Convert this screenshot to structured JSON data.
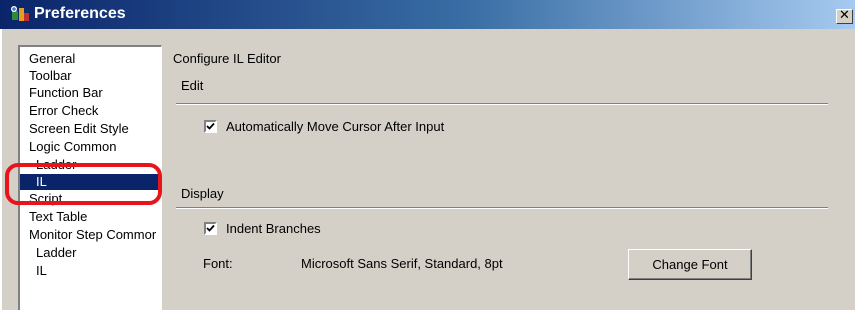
{
  "window": {
    "title": "Preferences",
    "close_glyph": "✕"
  },
  "tree": {
    "items": [
      {
        "label": "General"
      },
      {
        "label": "Toolbar"
      },
      {
        "label": "Function Bar"
      },
      {
        "label": "Error Check"
      },
      {
        "label": "Screen Edit Style"
      },
      {
        "label": "Logic Common"
      },
      {
        "label": "Ladder"
      },
      {
        "label": "IL"
      },
      {
        "label": "Script"
      },
      {
        "label": "Text Table"
      },
      {
        "label": "Monitor Step Commor"
      },
      {
        "label": "Ladder"
      },
      {
        "label": "IL"
      }
    ],
    "selected": "IL"
  },
  "panel": {
    "title": "Configure IL Editor",
    "edit_section": {
      "heading": "Edit",
      "auto_move_label": "Automatically Move Cursor After Input",
      "auto_move_checked": true
    },
    "display_section": {
      "heading": "Display",
      "indent_label": "Indent Branches",
      "indent_checked": true,
      "font_label": "Font:",
      "font_value": "Microsoft Sans Serif, Standard, 8pt",
      "change_font_button": "Change Font"
    }
  },
  "colors": {
    "selection": "#0a246a",
    "highlight_ring": "#e8141b",
    "dialog_bg": "#d4d0c8"
  }
}
